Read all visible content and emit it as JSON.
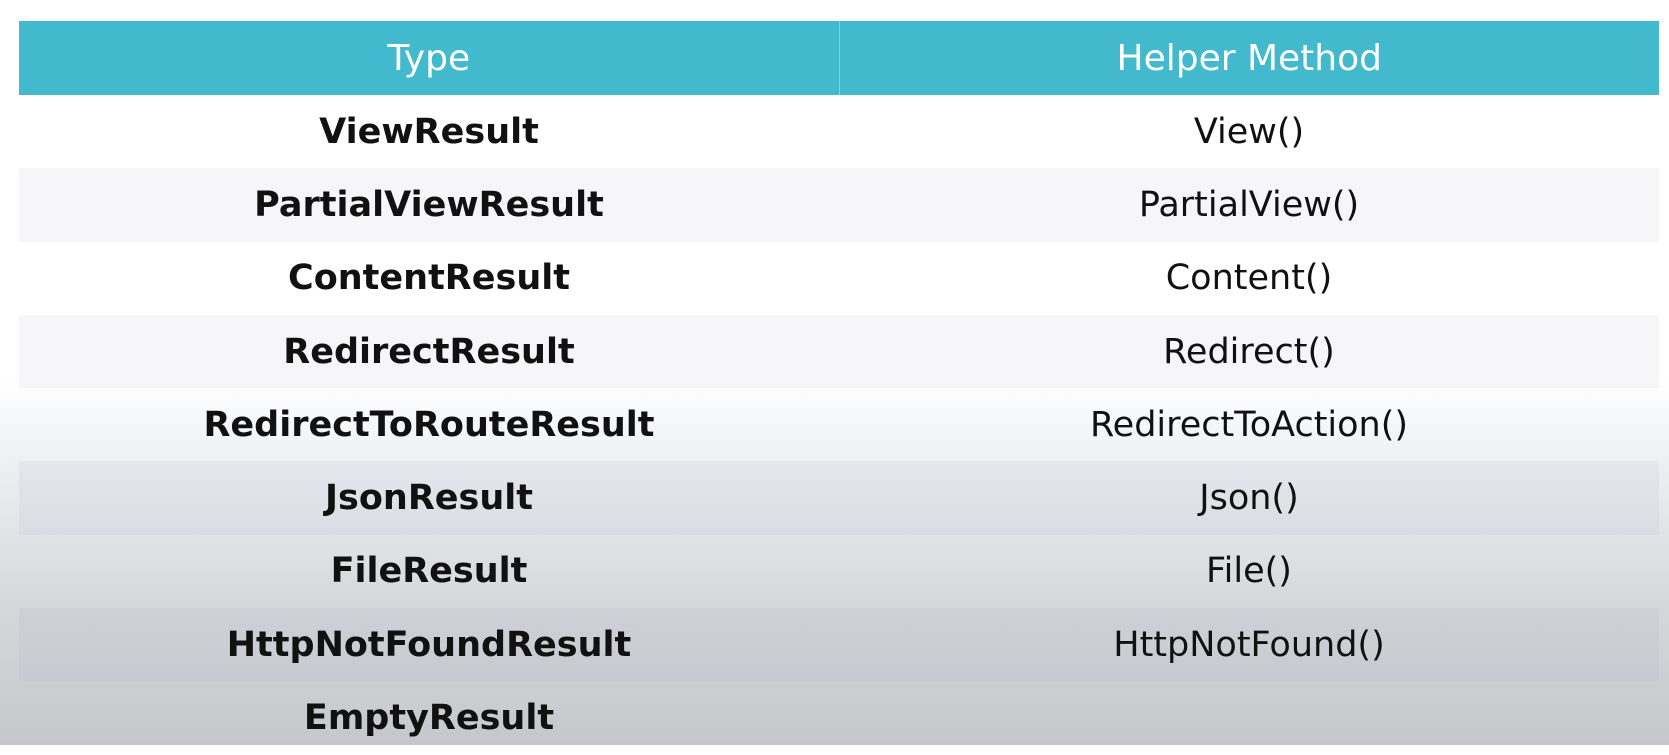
{
  "table": {
    "headers": {
      "type": "Type",
      "method": "Helper Method"
    },
    "rows": [
      {
        "type": "ViewResult",
        "method": "View()"
      },
      {
        "type": "PartialViewResult",
        "method": "PartialView()"
      },
      {
        "type": "ContentResult",
        "method": "Content()"
      },
      {
        "type": "RedirectResult",
        "method": "Redirect()"
      },
      {
        "type": "RedirectToRouteResult",
        "method": "RedirectToAction()"
      },
      {
        "type": "JsonResult",
        "method": "Json()"
      },
      {
        "type": "FileResult",
        "method": "File()"
      },
      {
        "type": "HttpNotFoundResult",
        "method": "HttpNotFound()"
      },
      {
        "type": "EmptyResult",
        "method": ""
      }
    ]
  },
  "colors": {
    "header_bg": "#43b9cd",
    "header_text": "#ffffff",
    "body_text": "#111111"
  }
}
